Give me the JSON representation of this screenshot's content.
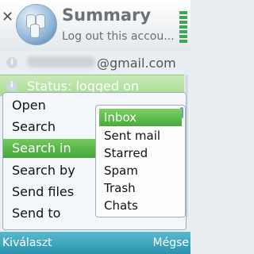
{
  "header": {
    "title": "Summary",
    "subtitle": "Log out this accou..."
  },
  "account": {
    "email_suffix": "@gmail.com"
  },
  "status": {
    "text": "Status: logged on"
  },
  "options_menu": {
    "items": [
      "Open",
      "Search",
      "Search in",
      "Search by",
      "Send files",
      "Send to"
    ],
    "selected": "Search in"
  },
  "submenu": {
    "items": [
      "Inbox",
      "Sent mail",
      "Starred",
      "Spam",
      "Trash",
      "Chats"
    ],
    "selected": "Inbox"
  },
  "softkeys": {
    "left": "Kiválaszt",
    "right": "Mégse"
  },
  "colors": {
    "selection": "#4fae42",
    "softkey_bar": "#2b93ad",
    "status_bg": "#b8e3a5"
  }
}
